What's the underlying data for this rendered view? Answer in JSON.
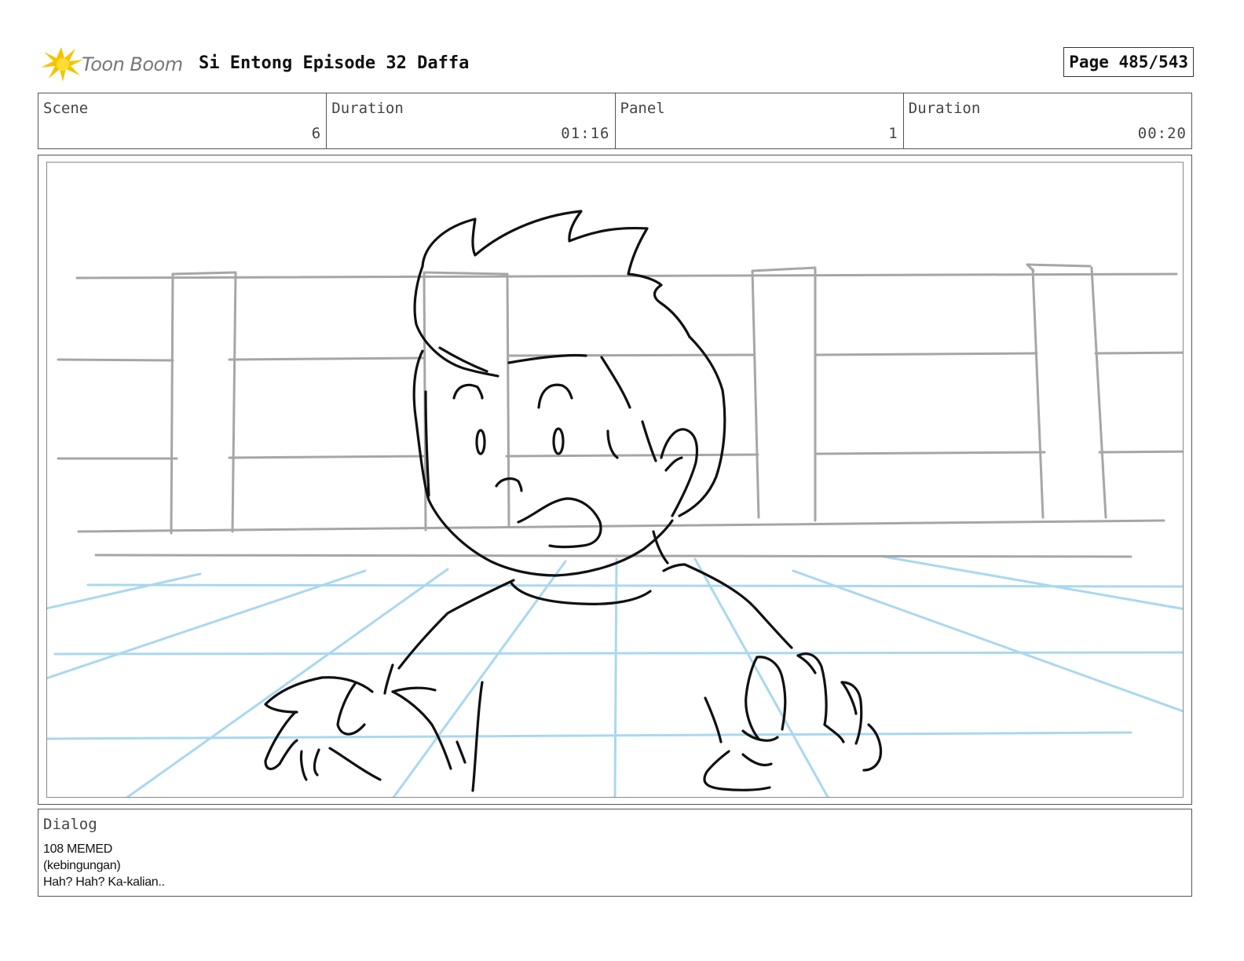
{
  "header": {
    "logo_text": "Toon Boom",
    "title": "Si Entong Episode 32 Daffa",
    "page": "Page 485/543"
  },
  "info": {
    "scene_label": "Scene",
    "scene_value": "6",
    "scene_duration_label": "Duration",
    "scene_duration_value": "01:16",
    "panel_label": "Panel",
    "panel_value": "1",
    "panel_duration_label": "Duration",
    "panel_duration_value": "00:20"
  },
  "dialog": {
    "label": "Dialog",
    "lines": [
      "108 MEMED",
      "(kebingungan)",
      "Hah? Hah? Ka-kalian.."
    ]
  },
  "colors": {
    "logo_accent": "#f5c400",
    "sketch_ink": "#111111",
    "background_sketch": "#a6a6a6",
    "perspective_grid": "#a9d8f0"
  }
}
